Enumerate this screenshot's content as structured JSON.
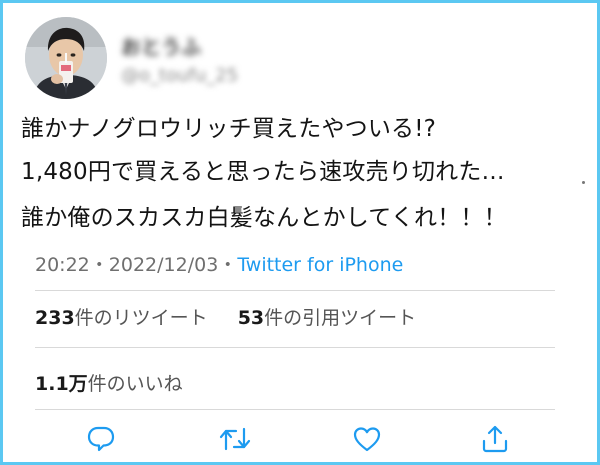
{
  "user": {
    "display_name": "おとうふ",
    "handle": "@o_toufu_25"
  },
  "tweet": {
    "lines": [
      "誰かナノグロウリッチ買えたやついる!?",
      "1,480円で買えると思ったら速攻売り切れた…",
      "誰か俺のスカスカ白髪なんとかしてくれ！！！"
    ]
  },
  "meta": {
    "time": "20:22",
    "sep1": "・",
    "date": "2022/12/03",
    "sep2": "・",
    "client": "Twitter for iPhone"
  },
  "stats": {
    "retweets_count": "233",
    "retweets_label": "件のリツイート",
    "quotes_count": "53",
    "quotes_label": "件の引用ツイート",
    "likes_count": "1.1万",
    "likes_label": "件のいいね"
  },
  "actions": {
    "reply_icon": "reply-icon",
    "retweet_icon": "retweet-icon",
    "like_icon": "heart-icon",
    "share_icon": "share-icon",
    "icon_color": "#1d9bf0"
  },
  "colors": {
    "frame_border": "#5bc8f2",
    "client_link": "#1d9bf0"
  }
}
